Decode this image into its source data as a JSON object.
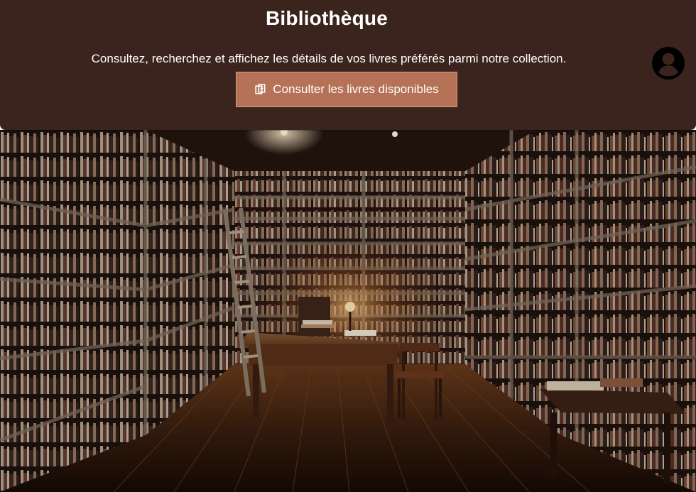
{
  "header": {
    "title": "Bibliothèque",
    "subtitle": "Consultez, recherchez et affichez les détails de vos livres préférés parmi notre collection.",
    "cta_label": "Consulter les livres disponibles",
    "cta_icon": "books-icon",
    "profile_icon": "user-profile-icon"
  },
  "hero": {
    "image_kind": "library-photo"
  },
  "colors": {
    "header_background": "#3b241d",
    "button_background": "#b57256",
    "button_border": "#d79b80",
    "text": "#ffffff"
  }
}
